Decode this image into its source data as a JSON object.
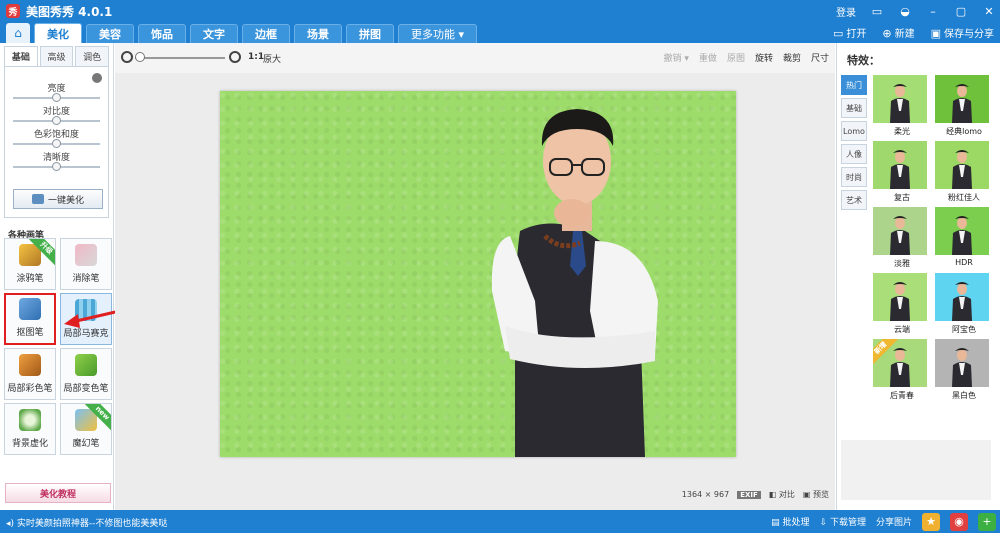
{
  "titlebar": {
    "title": "美图秀秀 4.0.1",
    "logo_text": "秀",
    "login": "登录",
    "window_controls": [
      "msg-icon",
      "skin-icon",
      "minimize-icon",
      "maximize-icon",
      "close-icon"
    ]
  },
  "tabs": [
    {
      "label": "美化",
      "active": true
    },
    {
      "label": "美容"
    },
    {
      "label": "饰品"
    },
    {
      "label": "文字"
    },
    {
      "label": "边框"
    },
    {
      "label": "场景"
    },
    {
      "label": "拼图"
    },
    {
      "label": "更多功能 ▾"
    }
  ],
  "tabbar_right": {
    "open": "打开",
    "new": "新建",
    "save": "保存与分享"
  },
  "left": {
    "subtabs": [
      "基础",
      "高级",
      "调色"
    ],
    "sliders": [
      {
        "label": "亮度",
        "value": 0.5
      },
      {
        "label": "对比度",
        "value": 0.5
      },
      {
        "label": "色彩饱和度",
        "value": 0.5
      },
      {
        "label": "清晰度",
        "value": 0.5
      }
    ],
    "one_key": "一键美化",
    "section_title": "各种画笔",
    "pens": [
      {
        "label": "涂鸦笔",
        "badge": "升级"
      },
      {
        "label": "消除笔"
      },
      {
        "label": "抠图笔",
        "highlight": true
      },
      {
        "label": "局部马赛克"
      },
      {
        "label": "局部彩色笔"
      },
      {
        "label": "局部变色笔"
      },
      {
        "label": "背景虚化"
      },
      {
        "label": "魔幻笔",
        "badge": "new"
      }
    ],
    "tutorial": "美化教程"
  },
  "canvas": {
    "ratio": "1:1",
    "orig": "原大",
    "tools": [
      {
        "label": "撤销 ▾",
        "enabled": false
      },
      {
        "label": "重做",
        "enabled": false
      },
      {
        "label": "原图",
        "enabled": false
      },
      {
        "label": "旋转",
        "enabled": true
      },
      {
        "label": "裁剪",
        "enabled": true
      },
      {
        "label": "尺寸",
        "enabled": true
      }
    ],
    "dimensions": "1364 × 967",
    "exif": "EXIF",
    "compare": "对比",
    "preview": "预览"
  },
  "right": {
    "title": "特效：",
    "categories": [
      "热门",
      "基础",
      "Lomo",
      "人像",
      "时尚",
      "艺术"
    ],
    "effects": [
      {
        "label": "柔光",
        "color": "#a4dd73"
      },
      {
        "label": "经典lomo",
        "color": "#6fc13c"
      },
      {
        "label": "复古",
        "color": "#9fd86c"
      },
      {
        "label": "粉红佳人",
        "color": "#9bd864"
      },
      {
        "label": "淡雅",
        "color": "#acd48a"
      },
      {
        "label": "HDR",
        "color": "#7cce4e"
      },
      {
        "label": "云端",
        "color": "#a9de79"
      },
      {
        "label": "阿宝色",
        "color": "#5fd4f0"
      },
      {
        "label": "后青春",
        "color": "#a8d97a",
        "badge": "新增"
      },
      {
        "label": "黑白色",
        "color": "#b4b4b4"
      }
    ]
  },
  "bottom": {
    "promo": "实时美颜拍照神器--不修图也能美美哒",
    "batch": "批处理",
    "download": "下载管理",
    "share": "分享图片"
  },
  "colors": {
    "brand": "#1f7fd0",
    "highlight": "#e02020",
    "photo_bg": "#9ddc6a"
  }
}
